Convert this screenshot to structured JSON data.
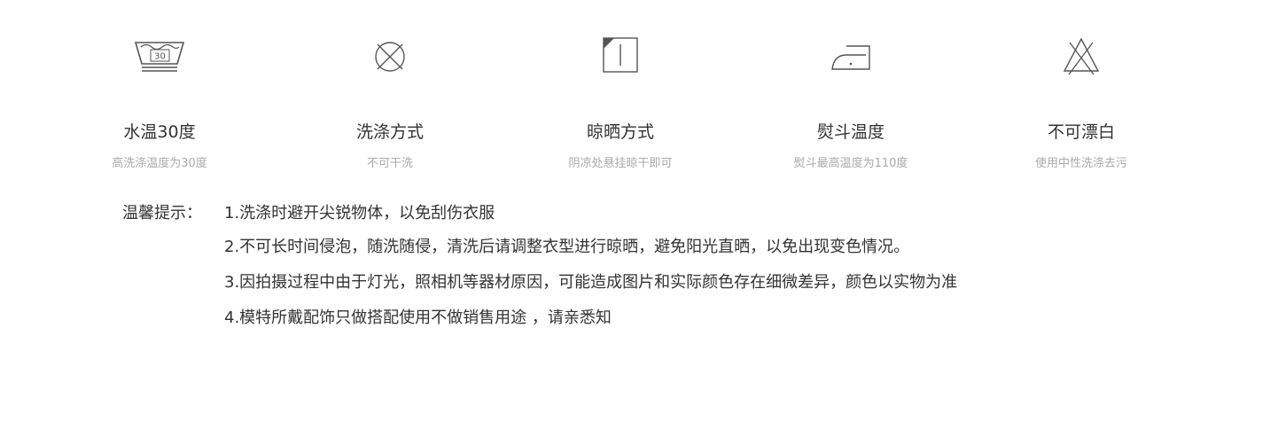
{
  "care_items": [
    {
      "icon": "wash-30-basin-icon",
      "tub_text": "30",
      "title": "水温30度",
      "desc": "高洗涤温度为30度"
    },
    {
      "icon": "do-not-tumble-dry-icon",
      "title": "洗涤方式",
      "desc": "不可干洗"
    },
    {
      "icon": "line-dry-shade-icon",
      "title": "晾晒方式",
      "desc": "阴凉处悬挂晾干即可"
    },
    {
      "icon": "iron-low-heat-icon",
      "title": "熨斗温度",
      "desc": "熨斗最高温度为110度"
    },
    {
      "icon": "do-not-bleach-icon",
      "title": "不可漂白",
      "desc": "使用中性洗涤去污"
    }
  ],
  "tips": {
    "label": "温馨提示：",
    "lines": [
      "1.洗涤时避开尖锐物体，以免刮伤衣服",
      "2.不可长时间侵泡，随洗随侵，清洗后请调整衣型进行晾晒，避免阳光直晒，以免出现变色情况。",
      "3.因拍摄过程中由于灯光，照相机等器材原因，可能造成图片和实际颜色存在细微差异，颜色以实物为准",
      "4.模特所戴配饰只做搭配使用不做销售用途 ，请亲悉知"
    ]
  },
  "colors": {
    "icon_stroke": "#555555",
    "title_text": "#333333",
    "desc_text": "#aaaaaa"
  }
}
